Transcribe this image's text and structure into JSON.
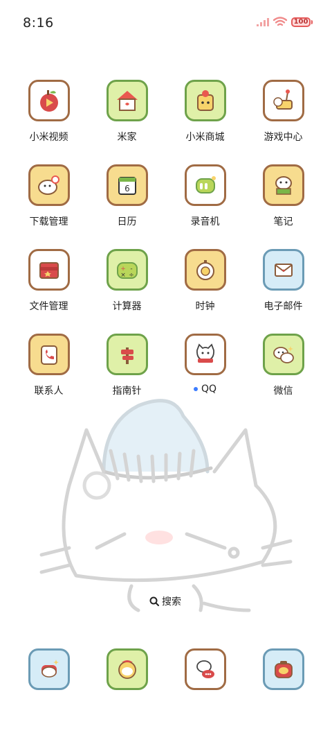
{
  "status_bar": {
    "time": "8:16",
    "battery": "100"
  },
  "apps": [
    {
      "label": "小米视频",
      "icon": "apple-video-icon",
      "bg": "#ffffff",
      "border": "#a06b44"
    },
    {
      "label": "米家",
      "icon": "house-icon",
      "bg": "#dff0a8",
      "border": "#6ea24a"
    },
    {
      "label": "小米商城",
      "icon": "store-bag-icon",
      "bg": "#dff0a8",
      "border": "#6ea24a"
    },
    {
      "label": "游戏中心",
      "icon": "joystick-icon",
      "bg": "#ffffff",
      "border": "#a06b44"
    },
    {
      "label": "下载管理",
      "icon": "download-cloud-icon",
      "bg": "#f7dc8f",
      "border": "#a06b44"
    },
    {
      "label": "日历",
      "icon": "calendar-icon",
      "bg": "#f7dc8f",
      "border": "#a06b44"
    },
    {
      "label": "录音机",
      "icon": "recorder-icon",
      "bg": "#ffffff",
      "border": "#a06b44"
    },
    {
      "label": "笔记",
      "icon": "notes-icon",
      "bg": "#f7dc8f",
      "border": "#a06b44"
    },
    {
      "label": "文件管理",
      "icon": "folder-icon",
      "bg": "#ffffff",
      "border": "#a06b44"
    },
    {
      "label": "计算器",
      "icon": "calculator-icon",
      "bg": "#dff0a8",
      "border": "#6ea24a"
    },
    {
      "label": "时钟",
      "icon": "clock-icon",
      "bg": "#f7dc8f",
      "border": "#a06b44"
    },
    {
      "label": "电子邮件",
      "icon": "envelope-icon",
      "bg": "#d6ecf7",
      "border": "#6b9bb5"
    },
    {
      "label": "联系人",
      "icon": "phone-book-icon",
      "bg": "#f7dc8f",
      "border": "#a06b44"
    },
    {
      "label": "指南针",
      "icon": "signpost-icon",
      "bg": "#dff0a8",
      "border": "#6ea24a"
    },
    {
      "label": "QQ",
      "icon": "cat-scarf-icon",
      "bg": "#ffffff",
      "border": "#a06b44"
    },
    {
      "label": "微信",
      "icon": "chat-cats-icon",
      "bg": "#dff0a8",
      "border": "#6ea24a"
    }
  ],
  "search": {
    "label": "搜索"
  },
  "dock": [
    {
      "icon": "cat-hat-icon",
      "bg": "#d6ecf7",
      "border": "#6b9bb5"
    },
    {
      "icon": "cat-globe-icon",
      "bg": "#dff0a8",
      "border": "#6ea24a"
    },
    {
      "icon": "message-bubble-icon",
      "bg": "#ffffff",
      "border": "#a06b44"
    },
    {
      "icon": "camera-icon",
      "bg": "#d6ecf7",
      "border": "#6b9bb5"
    }
  ]
}
